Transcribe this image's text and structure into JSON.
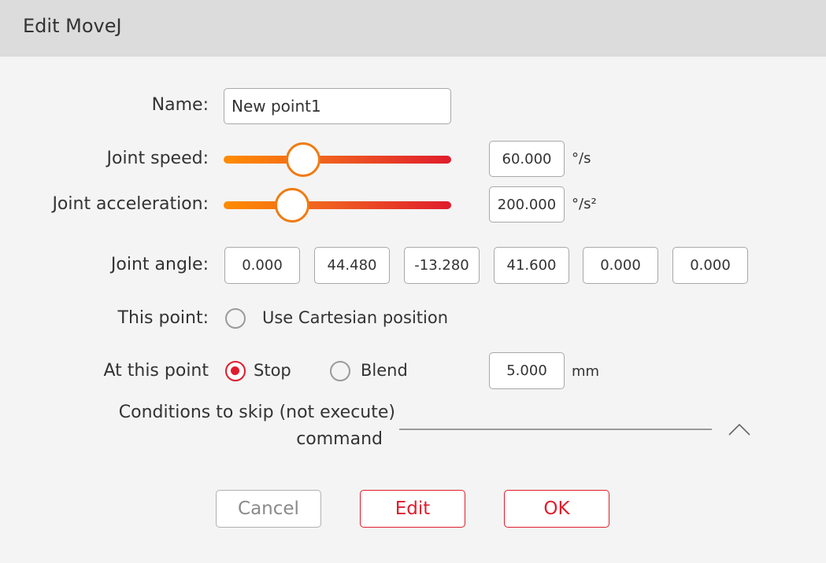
{
  "window": {
    "title": "Edit MoveJ"
  },
  "name": {
    "label": "Name:",
    "value": "New point1"
  },
  "joint_speed": {
    "label": "Joint speed:",
    "value": "60.000",
    "unit": "°/s",
    "slider_fraction": 0.35
  },
  "joint_acceleration": {
    "label": "Joint acceleration:",
    "value": "200.000",
    "unit": "°/s²",
    "slider_fraction": 0.3
  },
  "joint_angle": {
    "label": "Joint angle:",
    "values": [
      "0.000",
      "44.480",
      "-13.280",
      "41.600",
      "0.000",
      "0.000"
    ]
  },
  "this_point": {
    "label": "This point:",
    "option": "Use Cartesian position",
    "selected": false
  },
  "at_this_point": {
    "label": "At this point",
    "options": [
      "Stop",
      "Blend"
    ],
    "selected": "Stop",
    "blend_value": "5.000",
    "unit": "mm"
  },
  "conditions": {
    "line1": "Conditions to skip (not execute)",
    "line2": "command"
  },
  "buttons": {
    "cancel": "Cancel",
    "edit": "Edit",
    "ok": "OK"
  },
  "colors": {
    "accent": "#e01c2c",
    "slider_start": "#ff8c00",
    "knob_border": "#f07b12"
  },
  "icons": {
    "collapse": "chevron-up-icon"
  }
}
